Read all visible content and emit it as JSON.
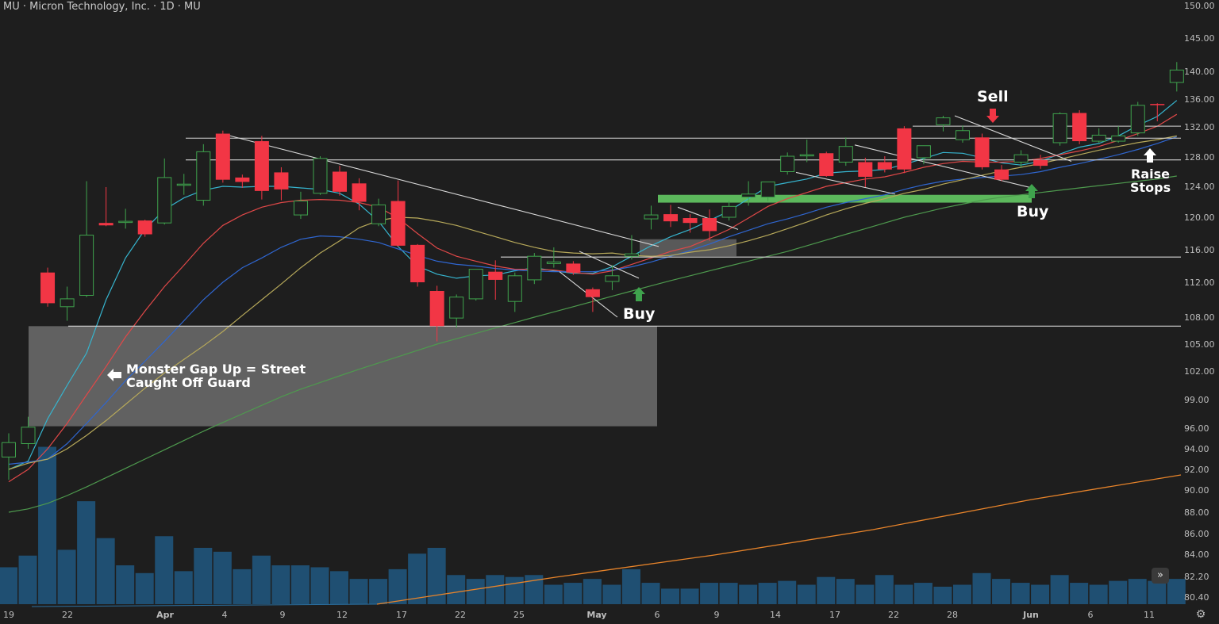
{
  "header": {
    "title": "MU · Micron Technology, Inc. · 1D · MU"
  },
  "controls": {
    "scroll_icon": "»",
    "settings_icon": "⚙"
  },
  "colors": {
    "background": "#1e1e1e",
    "up": "#3fa34d",
    "down": "#f23645",
    "ma_cyan": "#36b5cf",
    "ma_red": "#e04848",
    "ma_blue": "#2f66d0",
    "ma_tan": "#b7a95a",
    "ma_green": "#4e9a4e",
    "volume": "#1f4f72",
    "volume_ma": "#e8842a",
    "highlight_zone": "#5cb85c"
  },
  "annotations": {
    "gap_note_line1": "Monster Gap Up = Street",
    "gap_note_line2": "Caught Off Guard",
    "buy_1": "Buy",
    "buy_2": "Buy",
    "sell": "Sell",
    "raise_stops_line1": "Raise",
    "raise_stops_line2": "Stops"
  },
  "chart_data": {
    "type": "candlestick",
    "title": "MU · Micron Technology, Inc. · 1D · MU",
    "ylim": [
      79.5,
      150
    ],
    "y_ticks": [
      "150.00",
      "145.00",
      "140.00",
      "136.00",
      "132.00",
      "128.00",
      "124.00",
      "120.00",
      "116.00",
      "112.00",
      "108.00",
      "105.00",
      "102.00",
      "99.00",
      "96.00",
      "94.00",
      "92.00",
      "90.00",
      "88.00",
      "86.00",
      "84.00",
      "82.20",
      "80.40"
    ],
    "x_ticks": [
      "19",
      "22",
      "Apr",
      "4",
      "9",
      "12",
      "17",
      "22",
      "25",
      "May",
      "6",
      "9",
      "14",
      "17",
      "22",
      "28",
      "Jun",
      "6",
      "11"
    ],
    "candles": [
      {
        "o": 93.2,
        "h": 95.5,
        "l": 91.0,
        "c": 94.6
      },
      {
        "o": 94.5,
        "h": 97.2,
        "l": 94.0,
        "c": 96.1
      },
      {
        "o": 113.2,
        "h": 113.8,
        "l": 109.2,
        "c": 109.6
      },
      {
        "o": 109.2,
        "h": 111.5,
        "l": 107.6,
        "c": 110.1
      },
      {
        "o": 110.5,
        "h": 124.7,
        "l": 110.3,
        "c": 117.8
      },
      {
        "o": 119.3,
        "h": 123.9,
        "l": 118.9,
        "c": 119.0
      },
      {
        "o": 119.4,
        "h": 121.1,
        "l": 118.6,
        "c": 119.5
      },
      {
        "o": 119.6,
        "h": 119.7,
        "l": 117.6,
        "c": 117.9
      },
      {
        "o": 119.3,
        "h": 127.8,
        "l": 119.1,
        "c": 125.2
      },
      {
        "o": 124.2,
        "h": 125.7,
        "l": 122.9,
        "c": 124.3
      },
      {
        "o": 122.2,
        "h": 129.7,
        "l": 121.5,
        "c": 128.7
      },
      {
        "o": 131.1,
        "h": 131.5,
        "l": 124.5,
        "c": 124.9
      },
      {
        "o": 125.2,
        "h": 125.6,
        "l": 123.8,
        "c": 124.6
      },
      {
        "o": 130.1,
        "h": 130.8,
        "l": 122.3,
        "c": 123.4
      },
      {
        "o": 125.9,
        "h": 126.6,
        "l": 122.2,
        "c": 123.6
      },
      {
        "o": 120.3,
        "h": 123.3,
        "l": 119.8,
        "c": 122.1
      },
      {
        "o": 123.1,
        "h": 128.1,
        "l": 122.9,
        "c": 127.8
      },
      {
        "o": 126.0,
        "h": 126.8,
        "l": 122.8,
        "c": 123.3
      },
      {
        "o": 124.4,
        "h": 125.1,
        "l": 120.9,
        "c": 122.0
      },
      {
        "o": 119.2,
        "h": 122.4,
        "l": 118.9,
        "c": 121.6
      },
      {
        "o": 122.1,
        "h": 124.8,
        "l": 116.4,
        "c": 116.5
      },
      {
        "o": 116.6,
        "h": 116.7,
        "l": 111.5,
        "c": 112.0
      },
      {
        "o": 111.0,
        "h": 111.6,
        "l": 105.3,
        "c": 107.0
      },
      {
        "o": 107.9,
        "h": 110.6,
        "l": 106.8,
        "c": 110.3
      },
      {
        "o": 110.1,
        "h": 113.6,
        "l": 109.9,
        "c": 113.6
      },
      {
        "o": 113.3,
        "h": 114.7,
        "l": 110.0,
        "c": 112.3
      },
      {
        "o": 109.8,
        "h": 113.2,
        "l": 108.6,
        "c": 112.8
      },
      {
        "o": 112.3,
        "h": 115.6,
        "l": 111.8,
        "c": 115.2
      },
      {
        "o": 114.3,
        "h": 116.3,
        "l": 113.8,
        "c": 114.5
      },
      {
        "o": 114.3,
        "h": 114.6,
        "l": 112.9,
        "c": 113.2
      },
      {
        "o": 111.2,
        "h": 111.4,
        "l": 108.6,
        "c": 110.3
      },
      {
        "o": 112.1,
        "h": 114.1,
        "l": 111.1,
        "c": 112.8
      },
      {
        "o": 115.2,
        "h": 117.8,
        "l": 114.8,
        "c": 115.5
      },
      {
        "o": 119.8,
        "h": 121.5,
        "l": 118.5,
        "c": 120.3
      },
      {
        "o": 120.4,
        "h": 121.6,
        "l": 118.8,
        "c": 119.5
      },
      {
        "o": 119.9,
        "h": 120.4,
        "l": 118.1,
        "c": 119.3
      },
      {
        "o": 119.9,
        "h": 121.0,
        "l": 117.1,
        "c": 118.3
      },
      {
        "o": 120.0,
        "h": 122.1,
        "l": 119.6,
        "c": 121.4
      },
      {
        "o": 122.6,
        "h": 124.7,
        "l": 121.5,
        "c": 123.0
      },
      {
        "o": 122.6,
        "h": 124.6,
        "l": 122.1,
        "c": 124.6
      },
      {
        "o": 126.0,
        "h": 128.6,
        "l": 125.6,
        "c": 128.1
      },
      {
        "o": 128.2,
        "h": 130.3,
        "l": 127.3,
        "c": 128.3
      },
      {
        "o": 128.5,
        "h": 128.7,
        "l": 125.3,
        "c": 125.4
      },
      {
        "o": 127.3,
        "h": 130.6,
        "l": 126.8,
        "c": 129.4
      },
      {
        "o": 127.3,
        "h": 127.9,
        "l": 123.9,
        "c": 125.3
      },
      {
        "o": 127.3,
        "h": 128.1,
        "l": 125.9,
        "c": 126.3
      },
      {
        "o": 131.8,
        "h": 132.1,
        "l": 125.8,
        "c": 126.3
      },
      {
        "o": 127.9,
        "h": 129.4,
        "l": 127.0,
        "c": 129.5
      },
      {
        "o": 132.3,
        "h": 133.6,
        "l": 131.4,
        "c": 133.3
      },
      {
        "o": 130.3,
        "h": 132.2,
        "l": 129.9,
        "c": 131.5
      },
      {
        "o": 130.6,
        "h": 131.1,
        "l": 126.3,
        "c": 126.6
      },
      {
        "o": 126.3,
        "h": 126.9,
        "l": 124.7,
        "c": 124.9
      },
      {
        "o": 127.3,
        "h": 128.9,
        "l": 126.5,
        "c": 128.3
      },
      {
        "o": 127.6,
        "h": 128.3,
        "l": 126.4,
        "c": 126.8
      },
      {
        "o": 129.9,
        "h": 134.1,
        "l": 129.5,
        "c": 133.9
      },
      {
        "o": 134.0,
        "h": 134.4,
        "l": 129.7,
        "c": 130.1
      },
      {
        "o": 130.1,
        "h": 131.8,
        "l": 129.9,
        "c": 130.9
      },
      {
        "o": 130.1,
        "h": 132.1,
        "l": 129.9,
        "c": 130.8
      },
      {
        "o": 131.2,
        "h": 135.6,
        "l": 130.8,
        "c": 135.1
      },
      {
        "o": 135.3,
        "h": 135.4,
        "l": 132.8,
        "c": 135.2
      },
      {
        "o": 138.4,
        "h": 141.4,
        "l": 137.1,
        "c": 140.2
      }
    ],
    "volume": [
      1.9,
      2.5,
      8.1,
      2.8,
      5.3,
      3.4,
      2.0,
      1.6,
      3.5,
      1.7,
      2.9,
      2.7,
      1.8,
      2.5,
      2.0,
      2.0,
      1.9,
      1.7,
      1.3,
      1.3,
      1.8,
      2.6,
      2.9,
      1.5,
      1.3,
      1.5,
      1.4,
      1.5,
      1.0,
      1.1,
      1.3,
      1.0,
      1.8,
      1.1,
      0.8,
      0.8,
      1.1,
      1.1,
      1.0,
      1.1,
      1.2,
      1.0,
      1.4,
      1.3,
      1.0,
      1.5,
      1.0,
      1.1,
      0.9,
      1.0,
      1.6,
      1.3,
      1.1,
      1.0,
      1.5,
      1.1,
      1.0,
      1.2,
      1.3,
      1.2,
      1.3
    ],
    "moving_averages": [
      {
        "color": "#36b5cf",
        "values": [
          92.0,
          92.8,
          97.0,
          100.5,
          104.0,
          110.0,
          115.0,
          118.5,
          121.0,
          122.5,
          123.5,
          124.0,
          123.9,
          124.0,
          124.0,
          123.8,
          123.6,
          123.1,
          121.7,
          119.5,
          116.4,
          114.0,
          113.0,
          112.5,
          112.8,
          112.9,
          113.4,
          113.8,
          113.4,
          113.1,
          113.1,
          113.9,
          115.2,
          116.5,
          117.6,
          118.5,
          119.6,
          120.8,
          122.4,
          124.0,
          124.5,
          125.0,
          125.8,
          126.0,
          126.1,
          126.3,
          127.0,
          127.8,
          128.6,
          128.5,
          127.9,
          127.2,
          126.9,
          127.4,
          128.4,
          129.3,
          129.8,
          130.8,
          132.2,
          133.5,
          135.8
        ]
      },
      {
        "color": "#e04848",
        "values": [
          90.8,
          92.0,
          94.0,
          96.5,
          99.5,
          102.5,
          105.8,
          108.7,
          111.5,
          114.1,
          116.8,
          119.0,
          120.3,
          121.3,
          121.9,
          122.2,
          122.3,
          122.2,
          121.9,
          121.3,
          119.9,
          118.0,
          116.2,
          115.2,
          114.6,
          114.0,
          113.6,
          113.6,
          113.5,
          113.2,
          113.0,
          113.4,
          114.2,
          115.0,
          115.8,
          116.4,
          117.4,
          118.5,
          119.9,
          121.4,
          122.4,
          123.2,
          124.0,
          124.5,
          125.0,
          125.3,
          125.9,
          126.6,
          127.1,
          127.4,
          127.3,
          127.3,
          127.4,
          127.8,
          128.3,
          128.8,
          129.4,
          130.2,
          131.1,
          132.1,
          133.8
        ]
      },
      {
        "color": "#2f66d0",
        "values": [
          92.5,
          92.7,
          93.0,
          94.5,
          96.5,
          98.7,
          101.0,
          103.1,
          105.3,
          107.6,
          110.0,
          112.0,
          113.8,
          115.0,
          116.3,
          117.3,
          117.7,
          117.6,
          117.3,
          116.9,
          116.1,
          115.3,
          114.6,
          114.2,
          114.0,
          113.7,
          113.5,
          113.4,
          113.3,
          113.3,
          113.3,
          113.5,
          113.9,
          114.5,
          115.2,
          115.9,
          116.7,
          117.6,
          118.4,
          119.2,
          119.8,
          120.5,
          121.3,
          121.9,
          122.4,
          122.9,
          123.6,
          124.2,
          124.7,
          125.0,
          125.2,
          125.4,
          125.6,
          126.0,
          126.6,
          127.1,
          127.7,
          128.3,
          129.0,
          129.8,
          130.7
        ]
      },
      {
        "color": "#b7a95a",
        "values": [
          92.0,
          92.6,
          93.0,
          94.0,
          95.3,
          96.8,
          98.5,
          100.2,
          101.8,
          103.3,
          104.8,
          106.4,
          108.2,
          110.0,
          111.8,
          113.8,
          115.6,
          117.1,
          118.7,
          119.6,
          120.0,
          119.9,
          119.5,
          119.0,
          118.3,
          117.6,
          116.9,
          116.3,
          115.8,
          115.6,
          115.5,
          115.6,
          115.3,
          115.2,
          115.3,
          115.7,
          116.0,
          116.5,
          117.1,
          117.8,
          118.6,
          119.4,
          120.3,
          121.1,
          121.8,
          122.4,
          123.1,
          123.6,
          124.3,
          124.9,
          125.5,
          126.1,
          126.6,
          127.1,
          127.7,
          128.3,
          128.9,
          129.4,
          129.9,
          130.3,
          130.8
        ]
      },
      {
        "color": "#4e9a4e",
        "values": [
          88.0,
          88.3,
          88.8,
          89.5,
          90.3,
          91.2,
          92.1,
          93.0,
          93.9,
          94.8,
          95.7,
          96.6,
          97.5,
          98.4,
          99.3,
          100.1,
          100.8,
          101.5,
          102.2,
          102.9,
          103.6,
          104.3,
          105.0,
          105.6,
          106.2,
          106.8,
          107.4,
          108.0,
          108.6,
          109.2,
          109.8,
          110.4,
          111.0,
          111.6,
          112.2,
          112.8,
          113.4,
          114.0,
          114.6,
          115.2,
          115.8,
          116.5,
          117.2,
          117.9,
          118.6,
          119.3,
          120.0,
          120.6,
          121.2,
          121.7,
          122.2,
          122.6,
          122.9,
          123.2,
          123.5,
          123.8,
          124.1,
          124.4,
          124.7,
          125.0,
          125.4
        ]
      }
    ]
  }
}
